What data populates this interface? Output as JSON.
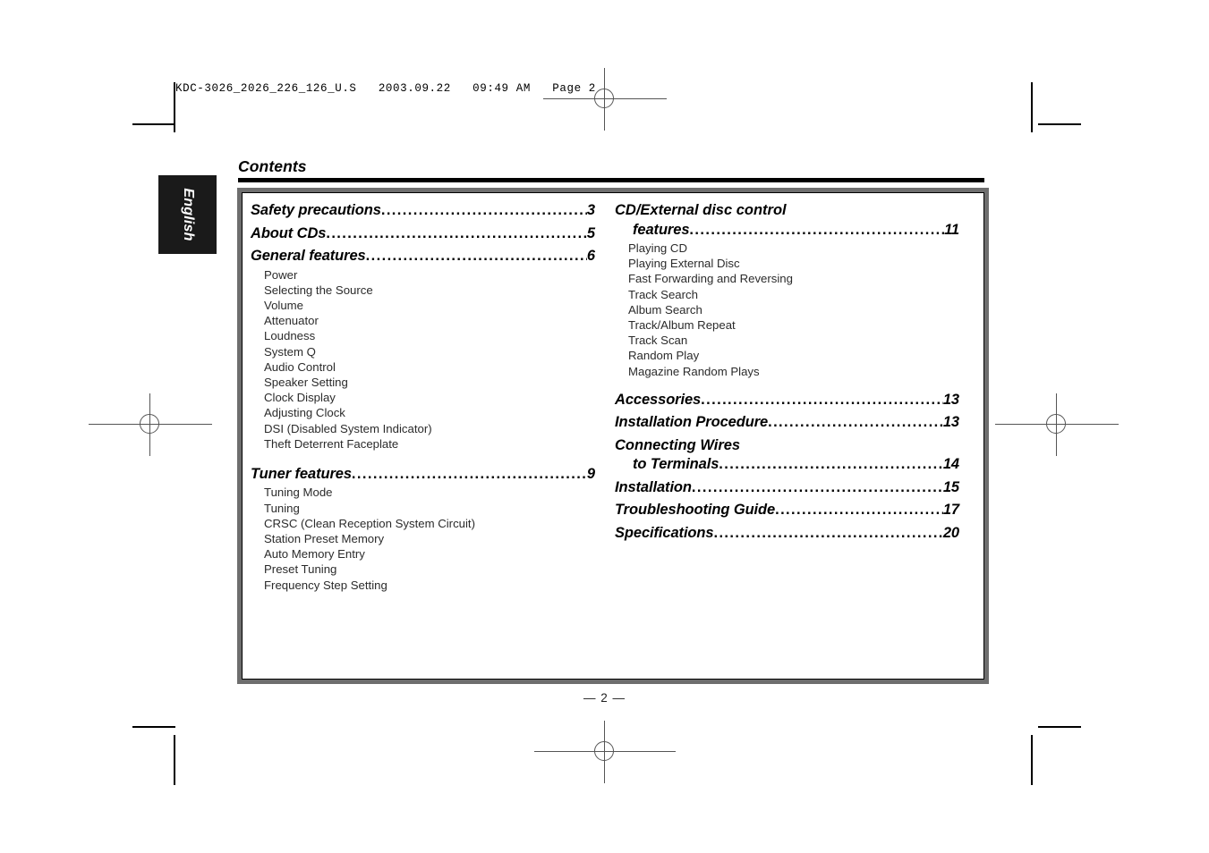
{
  "prepress": {
    "header_line": "KDC-3026_2026_226_126_U.S   2003.09.22   09:49 AM   Page 2"
  },
  "language_tab": {
    "label": "English"
  },
  "page": {
    "title": "Contents",
    "footer": "— 2 —"
  },
  "contents": {
    "left_column": [
      {
        "label": "Safety precautions",
        "dots": "........................................................",
        "page": "3",
        "sub": []
      },
      {
        "label": "About CDs",
        "dots": "........................................................",
        "page": "5",
        "sub": []
      },
      {
        "label": "General features ",
        "dots": "........................................................",
        "page": "6",
        "sub": [
          "Power",
          "Selecting the Source",
          "Volume",
          "Attenuator",
          "Loudness",
          "System Q",
          "Audio Control",
          "Speaker Setting",
          "Clock Display",
          "Adjusting Clock",
          "DSI (Disabled System Indicator)",
          "Theft Deterrent Faceplate"
        ]
      },
      {
        "label": "Tuner features ",
        "dots": "........................................................",
        "page": "9",
        "sub": [
          "Tuning Mode",
          "Tuning",
          "CRSC (Clean Reception System Circuit)",
          "Station Preset Memory",
          "Auto Memory Entry",
          "Preset Tuning",
          "Frequency Step Setting"
        ]
      }
    ],
    "right_column_wrapped": {
      "line1": "CD/External disc control",
      "line2": "features ",
      "dots": "........................................................",
      "page": "11",
      "sub": [
        "Playing CD",
        "Playing External Disc",
        "Fast Forwarding and Reversing",
        "Track Search",
        "Album Search",
        "Track/Album Repeat",
        "Track Scan",
        "Random Play",
        "Magazine Random Plays"
      ]
    },
    "right_column": [
      {
        "label": "Accessories",
        "dots": "........................................................",
        "page": "13"
      },
      {
        "label": "Installation Procedure ",
        "dots": "........................................................",
        "page": "13"
      }
    ],
    "right_column_wrapped2": {
      "line1": "Connecting Wires",
      "line2": "to Terminals ",
      "dots": "........................................................",
      "page": "14"
    },
    "right_column_tail": [
      {
        "label": "Installation ",
        "dots": "........................................................",
        "page": "15"
      },
      {
        "label": "Troubleshooting Guide ",
        "dots": "........................................................",
        "page": "17"
      },
      {
        "label": "Specifications ",
        "dots": "........................................................",
        "page": "20"
      }
    ]
  }
}
